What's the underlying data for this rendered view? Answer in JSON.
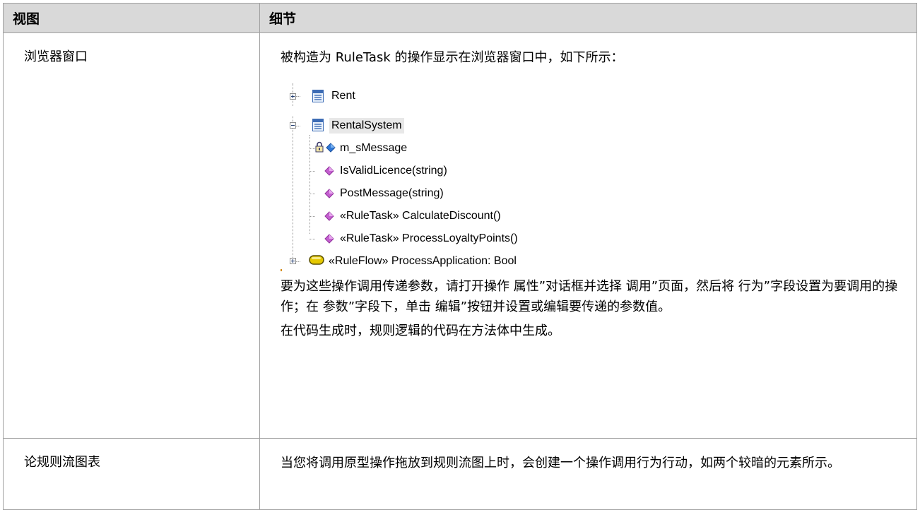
{
  "table": {
    "headers": [
      "视图",
      "细节"
    ],
    "rows": [
      {
        "view": "浏览器窗口",
        "intro": "被构造为 RuleTask 的操作显示在浏览器窗口中，如下所示：",
        "tree": {
          "items": [
            {
              "label": "Rent",
              "icon": "class-icon",
              "expander": "plus"
            },
            {
              "label": "RentalSystem",
              "icon": "class-icon",
              "expander": "minus",
              "selected": true
            },
            {
              "label": "m_sMessage",
              "icon": "lock-attribute-icon"
            },
            {
              "label": "IsValidLicence(string)",
              "icon": "operation-icon"
            },
            {
              "label": "PostMessage(string)",
              "icon": "operation-icon"
            },
            {
              "label": "«RuleTask» CalculateDiscount()",
              "icon": "operation-icon"
            },
            {
              "label": "«RuleTask» ProcessLoyaltyPoints()",
              "icon": "operation-icon"
            },
            {
              "label": "«RuleFlow» ProcessApplication: Bool",
              "icon": "activity-icon",
              "expander": "plus"
            }
          ]
        },
        "para2": "要为这些操作调用传递参数，请打开操作 属性”对话框并选择 调用”页面，然后将 行为”字段设置为要调用的操作；在 参数”字段下，单击 编辑”按钮并设置或编辑要传递的参数值。",
        "para3": "在代码生成时，规则逻辑的代码在方法体中生成。"
      },
      {
        "view": "论规则流图表",
        "detail": "当您将调用原型操作拖放到规则流图上时，会创建一个操作调用行为行动，如两个较暗的元素所示。"
      }
    ]
  },
  "colors": {
    "header_bg": "#d9d9d9",
    "border": "#a0a0a0",
    "operation": "#c45fd0",
    "attribute": "#2f78d8",
    "activity": "#e5c800"
  }
}
